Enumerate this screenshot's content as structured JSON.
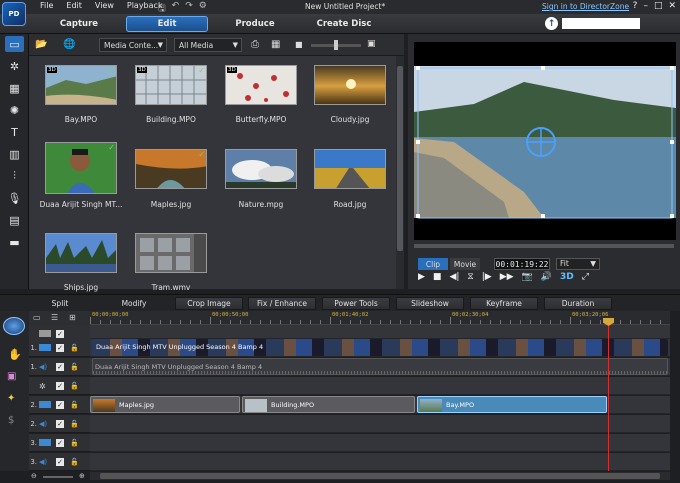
{
  "titlebar": {
    "logo_text": "PD",
    "menus": [
      "File",
      "Edit",
      "View",
      "Playback"
    ],
    "project_title": "New Untitled Project*",
    "signin": "Sign in to DirectorZone",
    "window_buttons": [
      "?",
      "–",
      "□",
      "✕"
    ]
  },
  "modes": [
    "Capture",
    "Edit",
    "Produce",
    "Create Disc"
  ],
  "active_mode": "Edit",
  "library": {
    "filter1": "Media Conte...",
    "filter2": "All Media",
    "items": [
      {
        "name": "Bay.MPO",
        "badge": "3D",
        "checked": true
      },
      {
        "name": "Building.MPO",
        "badge": "3D",
        "checked": true
      },
      {
        "name": "Butterfly.MPO",
        "badge": "3D",
        "checked": false
      },
      {
        "name": "Cloudy.jpg",
        "badge": "",
        "checked": false
      },
      {
        "name": "Duaa Arijit Singh MT...",
        "badge": "",
        "checked": true
      },
      {
        "name": "Maples.jpg",
        "badge": "",
        "checked": true
      },
      {
        "name": "Nature.mpg",
        "badge": "",
        "checked": false
      },
      {
        "name": "Road.jpg",
        "badge": "",
        "checked": false
      },
      {
        "name": "Ships.jpg",
        "badge": "",
        "checked": false
      },
      {
        "name": "Tram.wmv",
        "badge": "",
        "checked": false
      }
    ]
  },
  "preview": {
    "clip_label": "Clip",
    "movie_label": "Movie",
    "timecode": "00:01:19:22",
    "fit": "Fit",
    "d3_label": "3D"
  },
  "tabs": [
    "Split",
    "Modify",
    "Crop Image",
    "Fix / Enhance",
    "Power Tools",
    "Slideshow",
    "Keyframe",
    "Duration"
  ],
  "ruler": {
    "labels": [
      "00;00;00;00",
      "00;00;50;00",
      "00;01;40;02",
      "00;02;30;04",
      "00;03;20;06"
    ]
  },
  "tracks": [
    {
      "num": "",
      "kind": "chapter"
    },
    {
      "num": "1.",
      "kind": "video"
    },
    {
      "num": "1.",
      "kind": "audio"
    },
    {
      "num": "",
      "kind": "fx"
    },
    {
      "num": "2.",
      "kind": "video"
    },
    {
      "num": "2.",
      "kind": "audio"
    },
    {
      "num": "3.",
      "kind": "video"
    },
    {
      "num": "3.",
      "kind": "audio"
    }
  ],
  "clips": {
    "video1": "Duaa Arijit Singh MTV Unplugged Season 4 Bamp 4",
    "audio1": "Duaa Arijit Singh MTV Unplugged Season 4 Bamp 4",
    "maples": "Maples.jpg",
    "building": "Building.MPO",
    "bay": "Bay.MPO"
  }
}
